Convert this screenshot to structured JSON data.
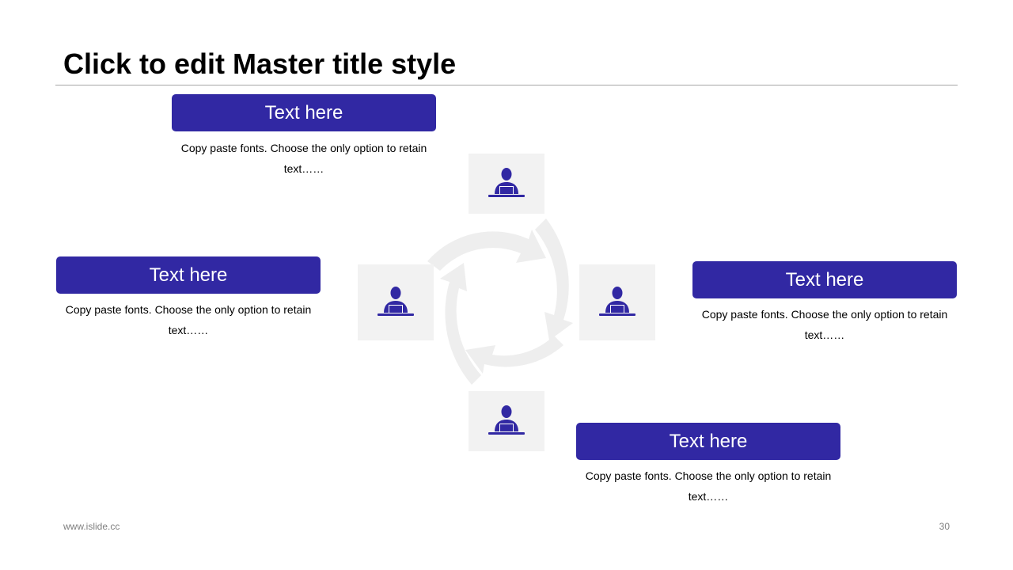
{
  "slide": {
    "title": "Click to edit Master title style",
    "footer_url": "www.islide.cc",
    "page_number": "30"
  },
  "colors": {
    "accent": "#3128a3",
    "tile_bg": "#f2f2f2",
    "arrow": "#f0f0f0",
    "rule": "#a6a6a6"
  },
  "items": [
    {
      "heading": "Text here",
      "text": "Copy paste fonts. Choose the only option to retain text……",
      "icon": "person-at-laptop-icon"
    },
    {
      "heading": "Text here",
      "text": "Copy paste fonts. Choose the only option to retain text……",
      "icon": "person-at-laptop-icon"
    },
    {
      "heading": "Text here",
      "text": "Copy paste fonts. Choose the only option to retain text……",
      "icon": "person-at-laptop-icon"
    },
    {
      "heading": "Text here",
      "text": "Copy paste fonts. Choose the only option to retain text……",
      "icon": "person-at-laptop-icon"
    }
  ]
}
